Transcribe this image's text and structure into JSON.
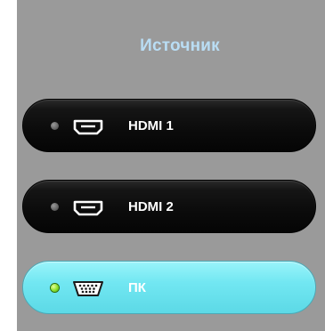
{
  "title": "Источник",
  "sources": [
    {
      "label": "HDMI 1",
      "icon": "hdmi-icon",
      "active": false
    },
    {
      "label": "HDMI 2",
      "icon": "hdmi-icon",
      "active": false
    },
    {
      "label": "ПК",
      "icon": "vga-icon",
      "active": true
    }
  ],
  "colors": {
    "panel_bg": "#9a9a9a",
    "title": "#b9ddf4",
    "inactive_button": "#0b0b0b",
    "active_button": "#72e7f2",
    "led_on": "#8adf28",
    "led_off": "#5a5a5a"
  }
}
